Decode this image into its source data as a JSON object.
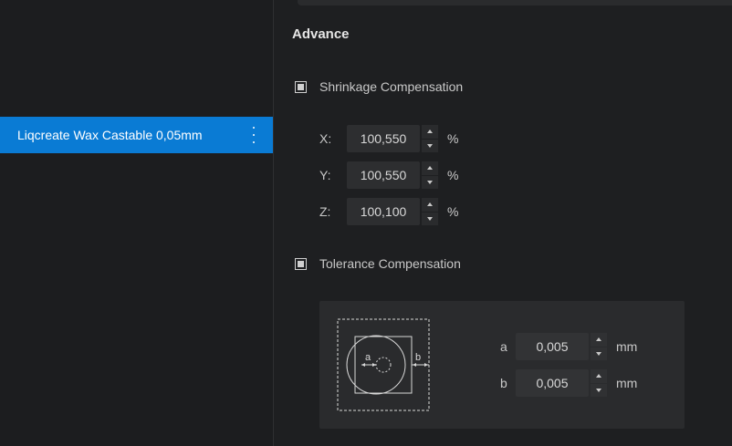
{
  "sidebar": {
    "selected_profile": "Liqcreate Wax Castable 0,05mm",
    "menu_icon": "kebab-menu-icon"
  },
  "main": {
    "section_title": "Advance",
    "shrinkage": {
      "label": "Shrinkage Compensation",
      "checked": true,
      "rows": [
        {
          "axis": "X:",
          "value": "100,550",
          "unit": "%"
        },
        {
          "axis": "Y:",
          "value": "100,550",
          "unit": "%"
        },
        {
          "axis": "Z:",
          "value": "100,100",
          "unit": "%"
        }
      ]
    },
    "tolerance": {
      "label": "Tolerance Compensation",
      "checked": true,
      "diagram_labels": {
        "a": "a",
        "b": "b"
      },
      "rows": [
        {
          "axis": "a",
          "value": "0,005",
          "unit": "mm"
        },
        {
          "axis": "b",
          "value": "0,005",
          "unit": "mm"
        }
      ]
    }
  },
  "colors": {
    "accent": "#0a7bd4",
    "background": "#1e1f21",
    "panel": "#2a2b2d"
  }
}
